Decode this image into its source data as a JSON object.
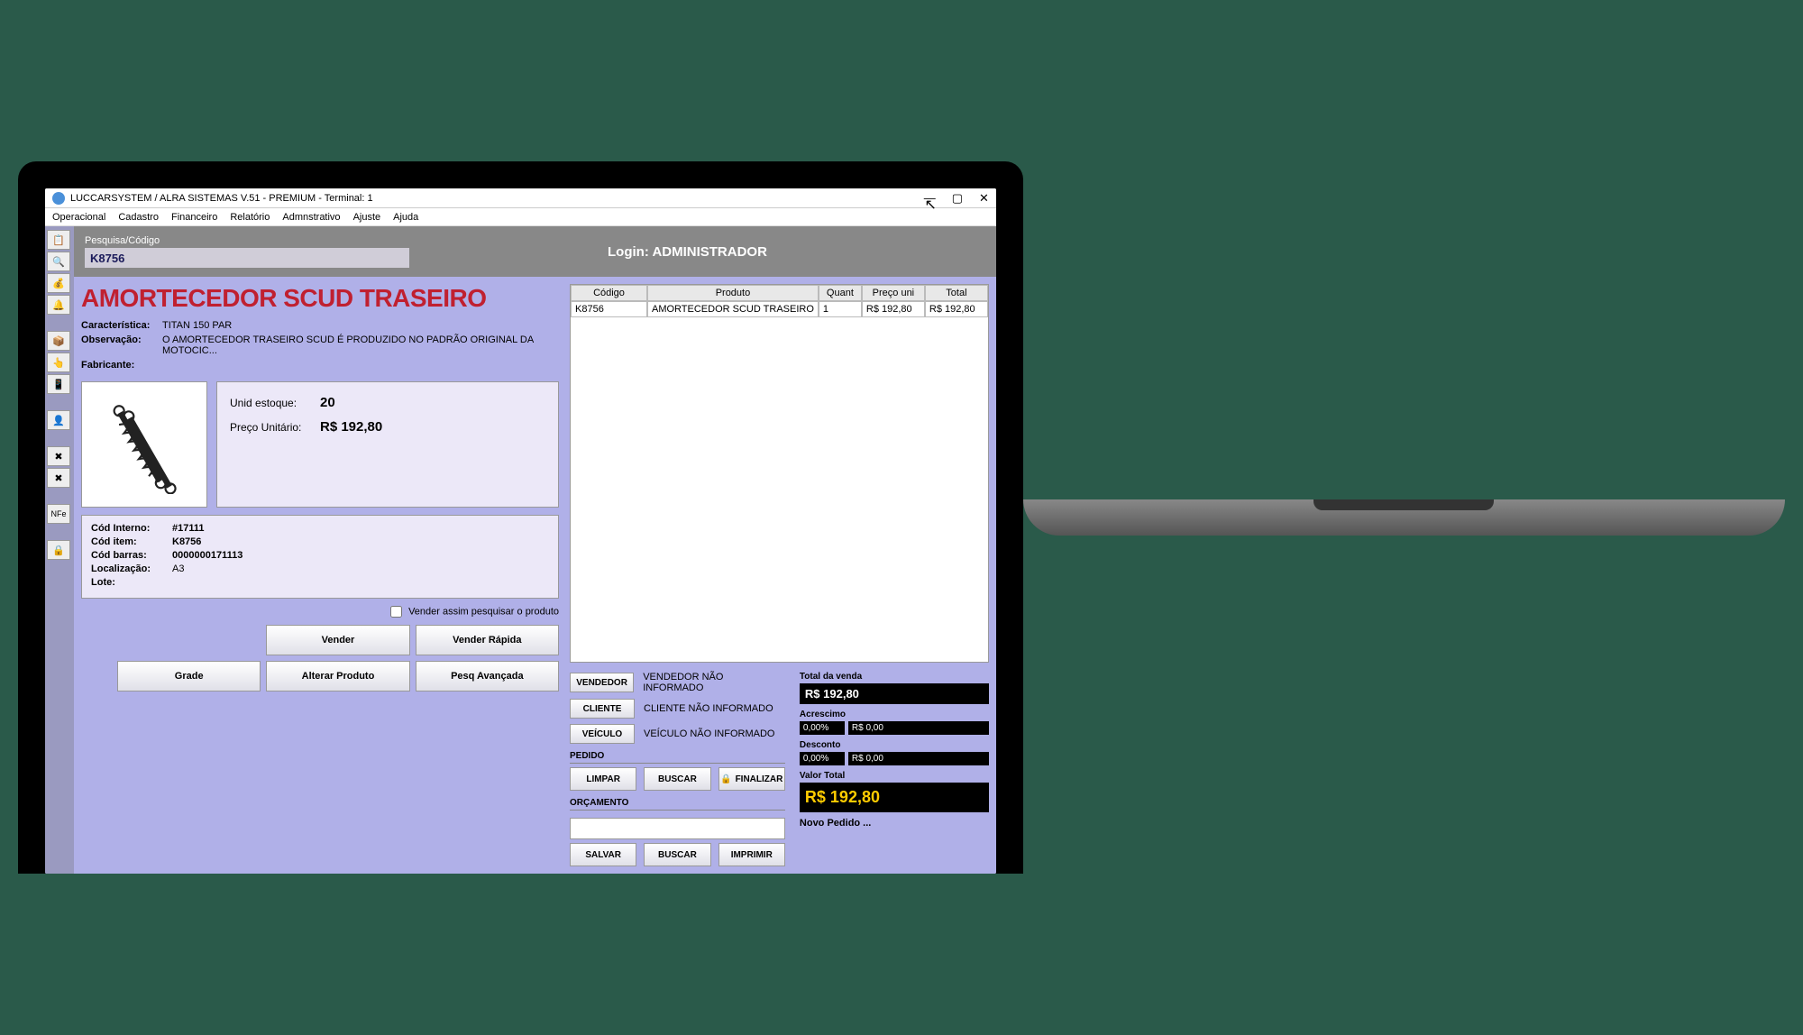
{
  "window": {
    "title": "LUCCARSYSTEM / ALRA SISTEMAS V.51 - PREMIUM - Terminal: 1",
    "controls": {
      "min": "—",
      "max": "▢",
      "close": "✕"
    }
  },
  "menu": [
    "Operacional",
    "Cadastro",
    "Financeiro",
    "Relatório",
    "Admnstrativo",
    "Ajuste",
    "Ajuda"
  ],
  "sidebar": [
    "📋",
    "🔍",
    "💰",
    "🔔",
    "📦",
    "👆",
    "📱",
    "👤",
    "✖",
    "✖",
    "NFe",
    "🔒"
  ],
  "search": {
    "label": "Pesquisa/Código",
    "value": "K8756"
  },
  "login": {
    "label": "Login: ",
    "user": "ADMINISTRADOR"
  },
  "product": {
    "name": "AMORTECEDOR SCUD TRASEIRO",
    "caracteristica_label": "Característica:",
    "caracteristica": "TITAN 150 PAR",
    "observacao_label": "Observação:",
    "observacao": "O AMORTECEDOR TRASEIRO SCUD É PRODUZIDO NO PADRÃO ORIGINAL DA MOTOCIC...",
    "fabricante_label": "Fabricante:",
    "fabricante": "",
    "unid_estoque_label": "Unid estoque:",
    "unid_estoque": "20",
    "preco_label": "Preço Unitário:",
    "preco": "R$ 192,80",
    "cod_interno_label": "Cód Interno:",
    "cod_interno": "#17111",
    "cod_item_label": "Cód item:",
    "cod_item": "K8756",
    "cod_barras_label": "Cód barras:",
    "cod_barras": "0000000171113",
    "localizacao_label": "Localização:",
    "localizacao": "A3",
    "lote_label": "Lote:",
    "lote": ""
  },
  "checkbox_label": "Vender assim pesquisar o produto",
  "buttons": {
    "vender": "Vender",
    "vender_rapida": "Vender Rápida",
    "grade": "Grade",
    "alterar": "Alterar Produto",
    "pesq": "Pesq Avançada"
  },
  "grid": {
    "headers": {
      "codigo": "Código",
      "produto": "Produto",
      "quant": "Quant",
      "preco_uni": "Preço uni",
      "total": "Total"
    },
    "row": {
      "codigo": "K8756",
      "produto": "AMORTECEDOR SCUD TRASEIRO",
      "quant": "1",
      "preco_uni": "R$ 192,80",
      "total": "R$ 192,80"
    }
  },
  "selectors": {
    "vendedor_btn": "VENDEDOR",
    "vendedor_txt": "VENDEDOR NÃO INFORMADO",
    "cliente_btn": "CLIENTE",
    "cliente_txt": "CLIENTE NÃO INFORMADO",
    "veiculo_btn": "VEÍCULO",
    "veiculo_txt": "VEÍCULO NÃO INFORMADO"
  },
  "pedido": {
    "label": "PEDIDO",
    "limpar": "LIMPAR",
    "buscar": "BUSCAR",
    "finalizar": "FINALIZAR"
  },
  "orcamento": {
    "label": "ORÇAMENTO",
    "salvar": "SALVAR",
    "buscar": "BUSCAR",
    "imprimir": "IMPRIMIR"
  },
  "totals": {
    "total_venda_label": "Total da venda",
    "total_venda": "R$ 192,80",
    "acrescimo_label": "Acrescimo",
    "acrescimo_pct": "0,00%",
    "acrescimo_val": "R$ 0,00",
    "desconto_label": "Desconto",
    "desconto_pct": "0,00%",
    "desconto_val": "R$ 0,00",
    "valor_total_label": "Valor Total",
    "valor_total": "R$ 192,80",
    "novo_pedido": "Novo Pedido ..."
  }
}
